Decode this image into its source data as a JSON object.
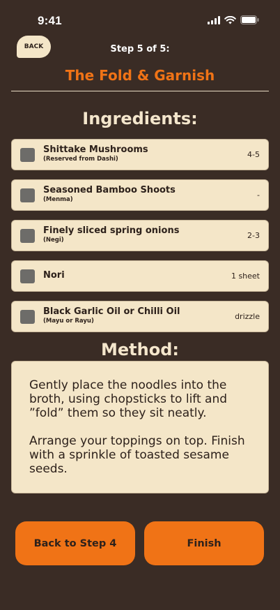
{
  "status_bar": {
    "time": "9:41"
  },
  "header": {
    "back_label": "BACK",
    "step_label": "Step 5 of 5:",
    "title": "The Fold & Garnish"
  },
  "ingredients": {
    "heading": "Ingredients:",
    "items": [
      {
        "name": "Shittake Mushrooms",
        "note": "(Reserved from Dashi)",
        "qty": "4-5",
        "checked": false
      },
      {
        "name": "Seasoned Bamboo Shoots",
        "note": "(Menma)",
        "qty": "-",
        "checked": false
      },
      {
        "name": "Finely sliced spring onions",
        "note": "(Negi)",
        "qty": "2-3",
        "checked": false
      },
      {
        "name": "Nori",
        "note": "",
        "qty": "1 sheet",
        "checked": false
      },
      {
        "name": "Black Garlic Oil or Chilli Oil",
        "note": "(Mayu or Rayu)",
        "qty": "drizzle",
        "checked": false
      }
    ]
  },
  "method": {
    "heading": "Method:",
    "paragraphs": [
      "Gently place the noodles into the broth, using chopsticks to lift and ”fold” them so they sit neatly.",
      "Arrange your toppings on top. Finish with a sprinkle of toasted sesame seeds."
    ]
  },
  "footer": {
    "back_step_label": "Back to Step 4",
    "finish_label": "Finish"
  },
  "colors": {
    "background": "#3a2c25",
    "accent": "#f07316",
    "card": "#f4e6c8",
    "checkbox": "#6d6c69"
  }
}
